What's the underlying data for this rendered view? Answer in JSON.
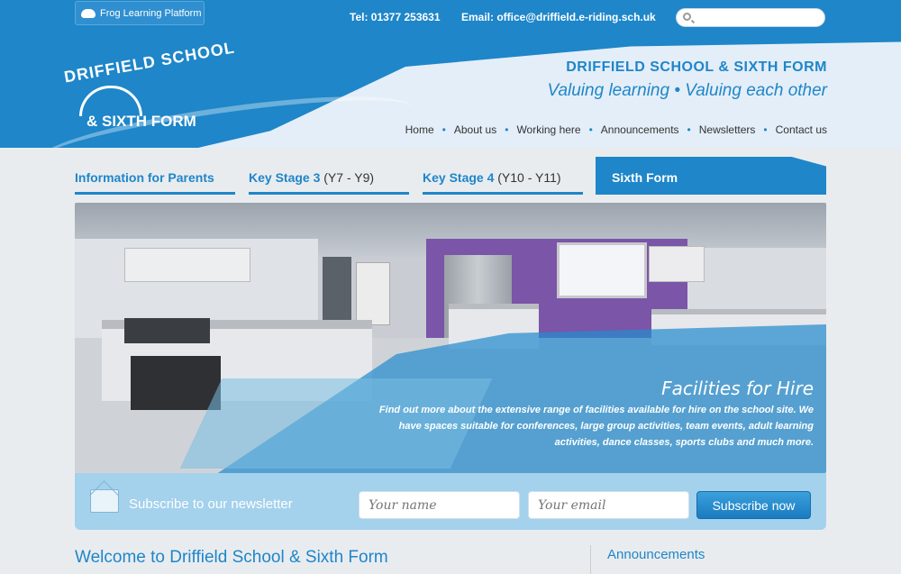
{
  "topbar": {
    "frog_label": "Frog Learning Platform",
    "tel": "Tel: 01377 253631",
    "email": "Email: office@driffield.e-riding.sch.uk",
    "search_placeholder": ""
  },
  "header": {
    "logo_line1": "DRIFFIELD SCHOOL",
    "logo_line2": "& SIXTH FORM",
    "school_title": "DRIFFIELD SCHOOL & SIXTH FORM",
    "tagline": "Valuing learning • Valuing each other",
    "nav": [
      "Home",
      "About us",
      "Working here",
      "Announcements",
      "Newsletters",
      "Contact us"
    ],
    "nav_separator": "•"
  },
  "tabs": [
    {
      "label": "Information for Parents",
      "range": ""
    },
    {
      "label": "Key Stage 3",
      "range": " (Y7 - Y9)"
    },
    {
      "label": "Key Stage 4",
      "range": " (Y10 - Y11)"
    },
    {
      "label": "Sixth Form",
      "range": ""
    }
  ],
  "hero": {
    "title": "Facilities for Hire",
    "text": "Find out more about the extensive range of facilities available for hire on the school site. We have spaces suitable for conferences, large group activities, team events, adult learning activities, dance classes, sports clubs and much more."
  },
  "newsletter": {
    "label": "Subscribe to our newsletter",
    "name_placeholder": "Your name",
    "email_placeholder": "Your email",
    "button": "Subscribe now"
  },
  "content": {
    "welcome": "Welcome to Driffield School & Sixth Form",
    "announcements": "Announcements"
  },
  "colors": {
    "brand_blue": "#1e86c9",
    "light_blue": "#a4d1ec"
  }
}
